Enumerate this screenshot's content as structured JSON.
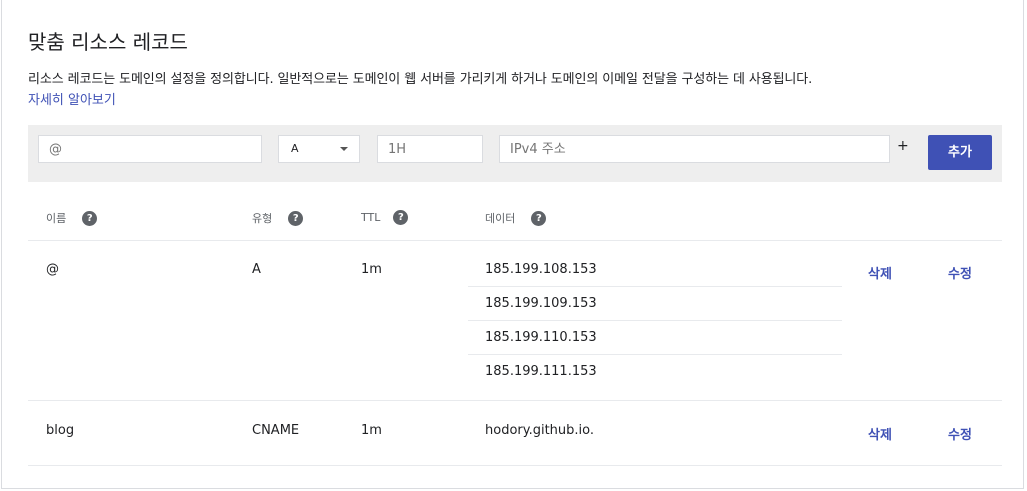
{
  "title": "맞춤 리소스 레코드",
  "description": "리소스 레코드는 도메인의 설정을 정의합니다. 일반적으로는 도메인이 웹 서버를 가리키게 하거나 도메인의 이메일 전달을 구성하는 데 사용됩니다.",
  "learn_more": "자세히 알아보기",
  "add_form": {
    "name_placeholder": "@",
    "type_value": "A",
    "ttl_placeholder": "1H",
    "data_placeholder": "IPv4 주소",
    "plus": "+",
    "add_label": "추가"
  },
  "columns": {
    "name": "이름",
    "type": "유형",
    "ttl": "TTL",
    "data": "데이터",
    "help_glyph": "?"
  },
  "records": [
    {
      "name": "@",
      "type": "A",
      "ttl": "1m",
      "data": [
        "185.199.108.153",
        "185.199.109.153",
        "185.199.110.153",
        "185.199.111.153"
      ],
      "delete": "삭제",
      "edit": "수정"
    },
    {
      "name": "blog",
      "type": "CNAME",
      "ttl": "1m",
      "data": [
        "hodory.github.io."
      ],
      "delete": "삭제",
      "edit": "수정"
    }
  ],
  "colors": {
    "accent": "#3f51b5",
    "bar_bg": "#eeeeee"
  }
}
